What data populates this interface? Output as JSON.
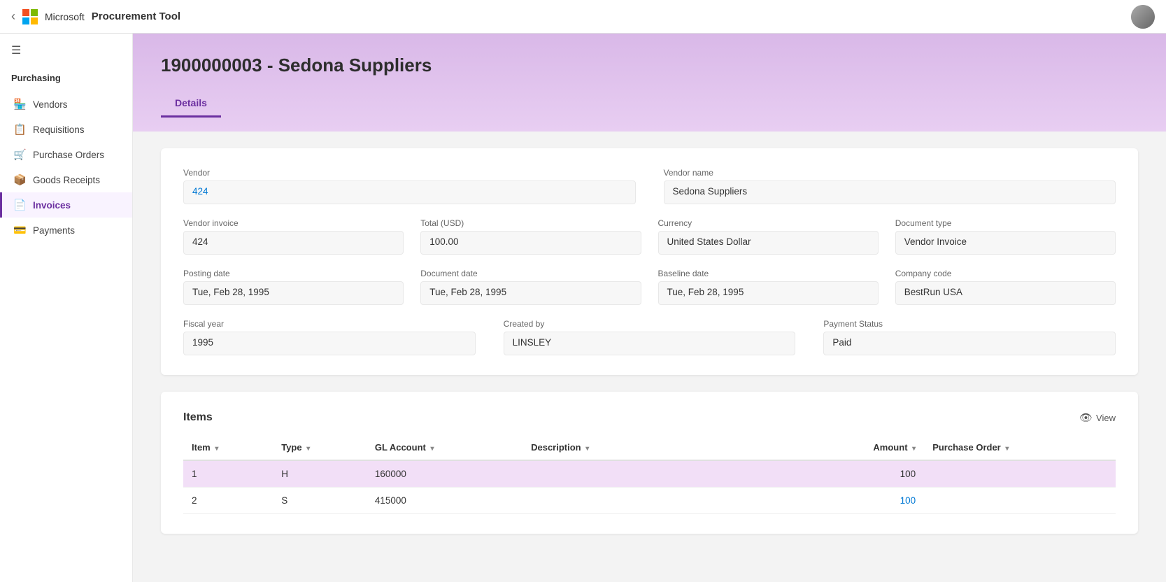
{
  "app": {
    "title": "Procurement Tool",
    "back_label": "‹"
  },
  "topbar": {
    "app_title": "Procurement Tool"
  },
  "sidebar": {
    "hamburger": "☰",
    "section_title": "Purchasing",
    "items": [
      {
        "id": "vendors",
        "label": "Vendors",
        "icon": "🏪",
        "active": false
      },
      {
        "id": "requisitions",
        "label": "Requisitions",
        "icon": "📋",
        "active": false
      },
      {
        "id": "purchase-orders",
        "label": "Purchase Orders",
        "icon": "🛒",
        "active": false
      },
      {
        "id": "goods-receipts",
        "label": "Goods Receipts",
        "icon": "📦",
        "active": false
      },
      {
        "id": "invoices",
        "label": "Invoices",
        "icon": "📄",
        "active": true
      },
      {
        "id": "payments",
        "label": "Payments",
        "icon": "💳",
        "active": false
      }
    ]
  },
  "page": {
    "title": "1900000003 - Sedona Suppliers",
    "tabs": [
      {
        "id": "details",
        "label": "Details",
        "active": true
      }
    ]
  },
  "details": {
    "vendor_label": "Vendor",
    "vendor_value": "424",
    "vendor_name_label": "Vendor name",
    "vendor_name_value": "Sedona Suppliers",
    "vendor_invoice_label": "Vendor invoice",
    "vendor_invoice_value": "424",
    "total_label": "Total (USD)",
    "total_value": "100.00",
    "currency_label": "Currency",
    "currency_value": "United States Dollar",
    "document_type_label": "Document type",
    "document_type_value": "Vendor Invoice",
    "posting_date_label": "Posting date",
    "posting_date_value": "Tue, Feb 28, 1995",
    "document_date_label": "Document date",
    "document_date_value": "Tue, Feb 28, 1995",
    "baseline_date_label": "Baseline date",
    "baseline_date_value": "Tue, Feb 28, 1995",
    "company_code_label": "Company code",
    "company_code_value": "BestRun USA",
    "fiscal_year_label": "Fiscal year",
    "fiscal_year_value": "1995",
    "created_by_label": "Created by",
    "created_by_value": "LINSLEY",
    "payment_status_label": "Payment Status",
    "payment_status_value": "Paid"
  },
  "items_section": {
    "title": "Items",
    "view_button": "View",
    "columns": [
      {
        "id": "item",
        "label": "Item"
      },
      {
        "id": "type",
        "label": "Type"
      },
      {
        "id": "gl_account",
        "label": "GL Account"
      },
      {
        "id": "description",
        "label": "Description"
      },
      {
        "id": "amount",
        "label": "Amount"
      },
      {
        "id": "purchase_order",
        "label": "Purchase Order"
      }
    ],
    "rows": [
      {
        "item": "1",
        "type": "H",
        "gl_account": "160000",
        "description": "",
        "amount": "100",
        "purchase_order": "",
        "highlighted": true,
        "amount_link": false
      },
      {
        "item": "2",
        "type": "S",
        "gl_account": "415000",
        "description": "",
        "amount": "100",
        "purchase_order": "",
        "highlighted": false,
        "amount_link": true
      }
    ]
  },
  "colors": {
    "accent": "#6b2fa0",
    "link": "#0078d4",
    "highlight_row": "#f2dff7"
  }
}
